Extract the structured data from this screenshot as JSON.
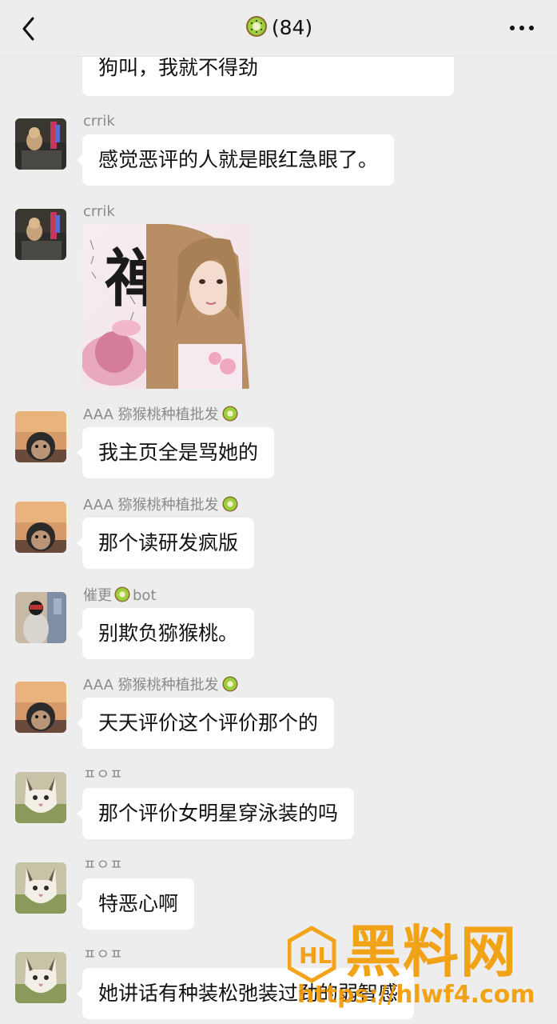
{
  "header": {
    "title": "(84)",
    "title_icon": "kiwi-icon",
    "back_icon": "chevron-left-icon",
    "more_icon": "more-dots-icon"
  },
  "messages": [
    {
      "sender": "",
      "text": "狗叫，我就不得劲"
    },
    {
      "sender": "crrik",
      "text": "感觉恶评的人就是眼红急眼了。"
    },
    {
      "sender": "crrik",
      "sticker_text": "禅"
    },
    {
      "sender": "AAA 猕猴桃种植批发",
      "text": "我主页全是骂她的"
    },
    {
      "sender": "AAA 猕猴桃种植批发",
      "text": "那个读研发疯版"
    },
    {
      "sender_prefix": "催更",
      "sender_suffix": "bot",
      "text": "别欺负猕猴桃。"
    },
    {
      "sender": "AAA 猕猴桃种植批发",
      "text": "天天评价这个评价那个的"
    },
    {
      "sender": "ㅍㅇㅍ",
      "text": "那个评价女明星穿泳装的吗"
    },
    {
      "sender": "ㅍㅇㅍ",
      "text": "特恶心啊"
    },
    {
      "sender": "ㅍㅇㅍ",
      "text": "她讲话有种装松弛装过劲的弱智感"
    }
  ],
  "watermark": {
    "brand": "黑料网",
    "url": "https://hlwf4.com"
  },
  "colors": {
    "background": "#ededed",
    "bubble": "#ffffff",
    "sender_name": "#8a8a8a",
    "watermark": "#f29a00"
  }
}
